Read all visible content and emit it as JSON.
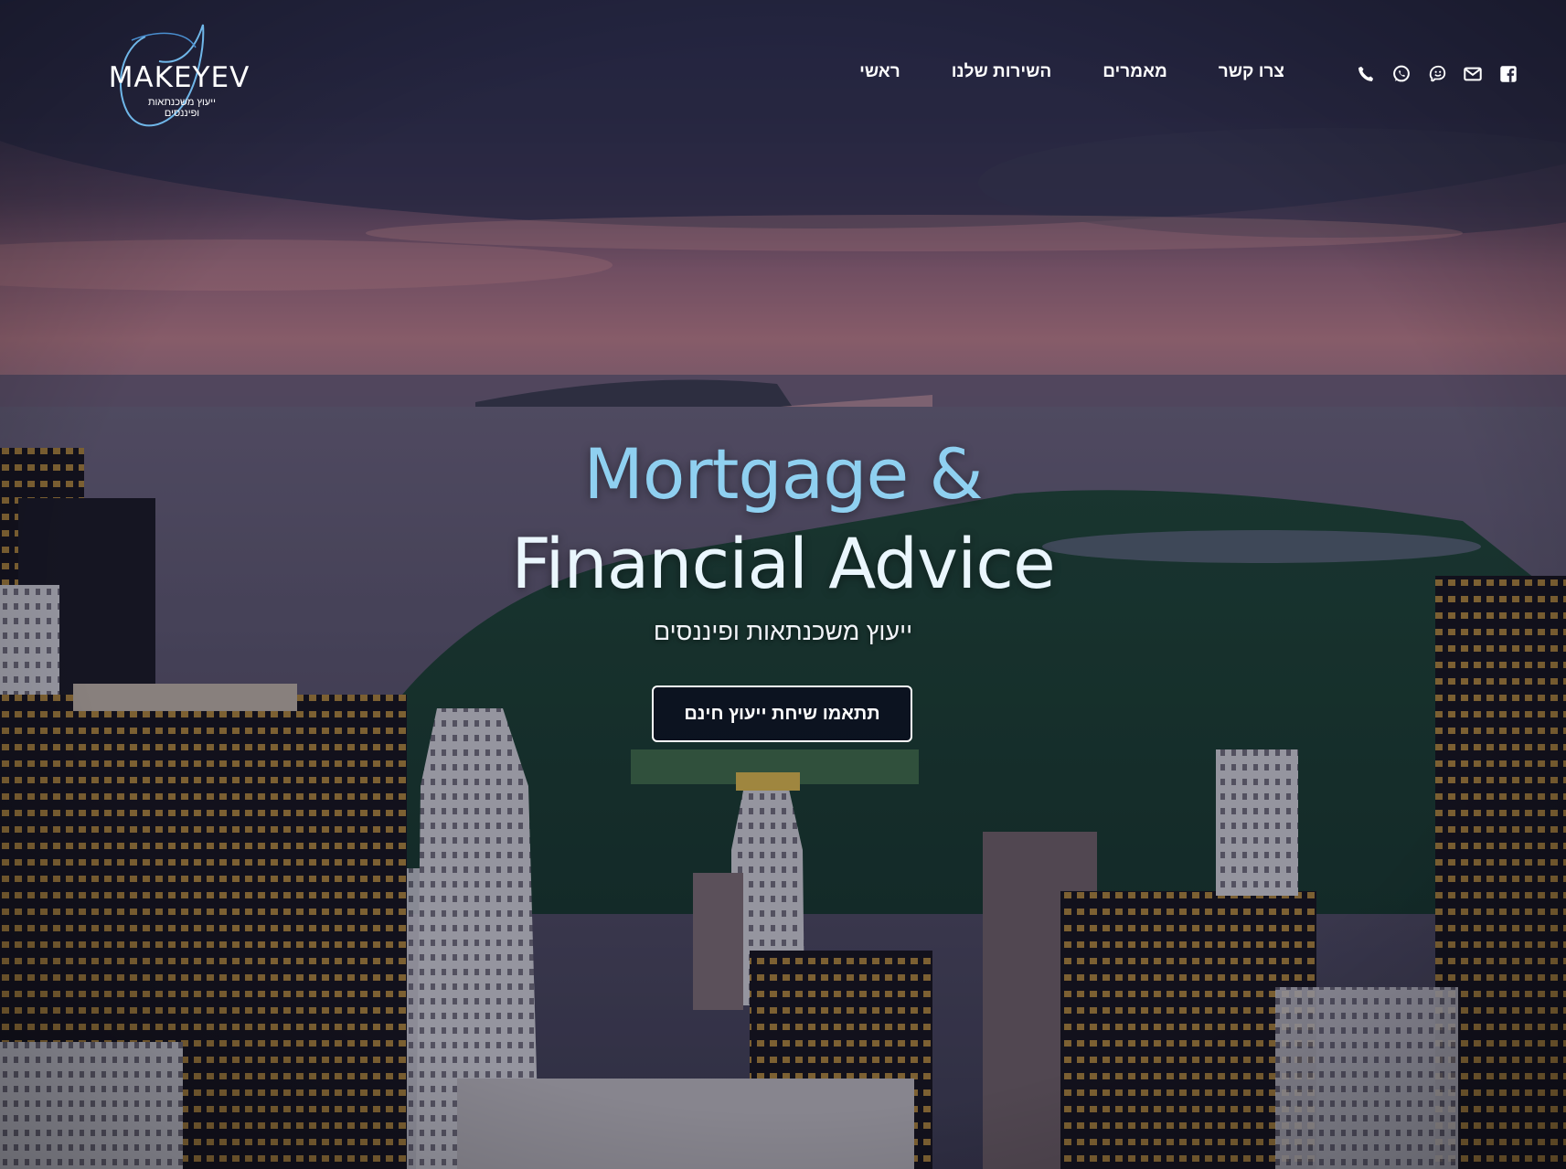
{
  "brand": {
    "name": "MAKEYEV",
    "tagline": "ייעוץ משכנתאות ופיננסים"
  },
  "nav": {
    "items": [
      {
        "label": "ראשי"
      },
      {
        "label": "השירות שלנו"
      },
      {
        "label": "מאמרים"
      },
      {
        "label": "צרו קשר"
      }
    ]
  },
  "social": {
    "icons": [
      "phone-icon",
      "whatsapp-icon",
      "waze-icon",
      "email-icon",
      "facebook-icon"
    ]
  },
  "hero": {
    "headline_line1": "Mortgage &",
    "headline_line2": "Financial Advice",
    "subtitle": "ייעוץ משכנתאות ופיננסים",
    "cta_label": "תתאמו שיחת ייעוץ חינם"
  },
  "colors": {
    "headline_accent": "#8fd0f0",
    "headline_light": "#eaf6fd",
    "cta_background": "#0a0e1e",
    "text": "#ffffff"
  }
}
